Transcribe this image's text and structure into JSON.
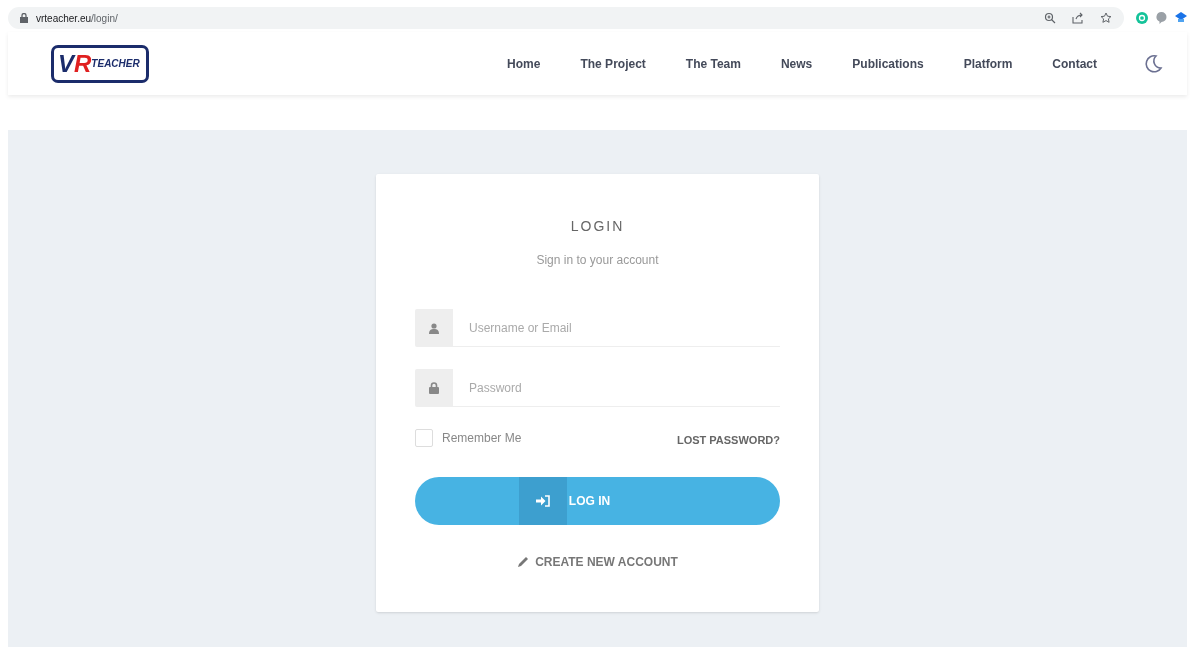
{
  "browser": {
    "url_host": "vrteacher.eu",
    "url_path": "/login/"
  },
  "logo": {
    "mark_v": "V",
    "mark_r": "R",
    "text": "TEACHER"
  },
  "nav": [
    {
      "label": "Home"
    },
    {
      "label": "The Project"
    },
    {
      "label": "The Team"
    },
    {
      "label": "News"
    },
    {
      "label": "Publications"
    },
    {
      "label": "Platform"
    },
    {
      "label": "Contact"
    }
  ],
  "login": {
    "title": "LOGIN",
    "subtitle": "Sign in to your account",
    "fields": [
      {
        "kind": "user",
        "placeholder": "Username or Email"
      },
      {
        "kind": "password",
        "placeholder": "Password"
      }
    ],
    "remember": {
      "label": "Remember Me",
      "checked": false
    },
    "lost_password": "LOST PASSWORD?",
    "submit": "LOG IN",
    "create_account": "CREATE NEW ACCOUNT"
  }
}
